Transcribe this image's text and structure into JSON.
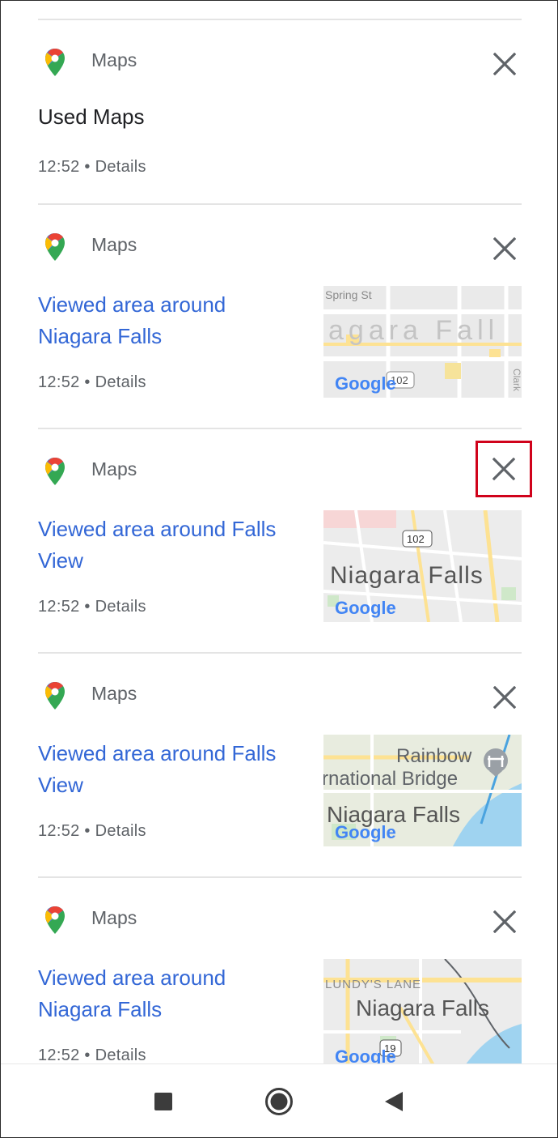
{
  "activity": {
    "items": [
      {
        "app": "Maps",
        "title": "Used Maps",
        "time": "12:52",
        "details": "Details",
        "has_thumb": false
      },
      {
        "app": "Maps",
        "title": "Viewed area around Niagara Falls",
        "time": "12:52",
        "details": "Details",
        "has_thumb": true,
        "map": {
          "street": "Spring St",
          "big_label": "agara Fall",
          "route": "102",
          "side_label": "Clark",
          "logo": "Google"
        }
      },
      {
        "app": "Maps",
        "title": "Viewed area around Falls View",
        "time": "12:52",
        "details": "Details",
        "has_thumb": true,
        "highlighted_close": true,
        "map": {
          "route": "102",
          "big_label": "Niagara Falls",
          "logo": "Google"
        }
      },
      {
        "app": "Maps",
        "title": "Viewed area around Falls View",
        "time": "12:52",
        "details": "Details",
        "has_thumb": true,
        "map": {
          "line1": "Rainbow",
          "line2": "rnational Bridge",
          "big_label": "Niagara Falls",
          "logo": "Google"
        }
      },
      {
        "app": "Maps",
        "title": "Viewed area around Niagara Falls",
        "time": "12:52",
        "details": "Details",
        "has_thumb": true,
        "map": {
          "street": "LUNDY'S LANE",
          "big_label": "Niagara Falls",
          "route": "19",
          "logo": "Google"
        }
      }
    ],
    "separator": "•"
  },
  "icons": {
    "pin": "google-maps-pin-icon",
    "close": "close-icon",
    "nav_recents": "square-icon",
    "nav_home": "circle-icon",
    "nav_back": "triangle-back-icon"
  },
  "colors": {
    "link": "#3367d6",
    "highlight_border": "#d0021b",
    "secondary_text": "#5f6368"
  }
}
